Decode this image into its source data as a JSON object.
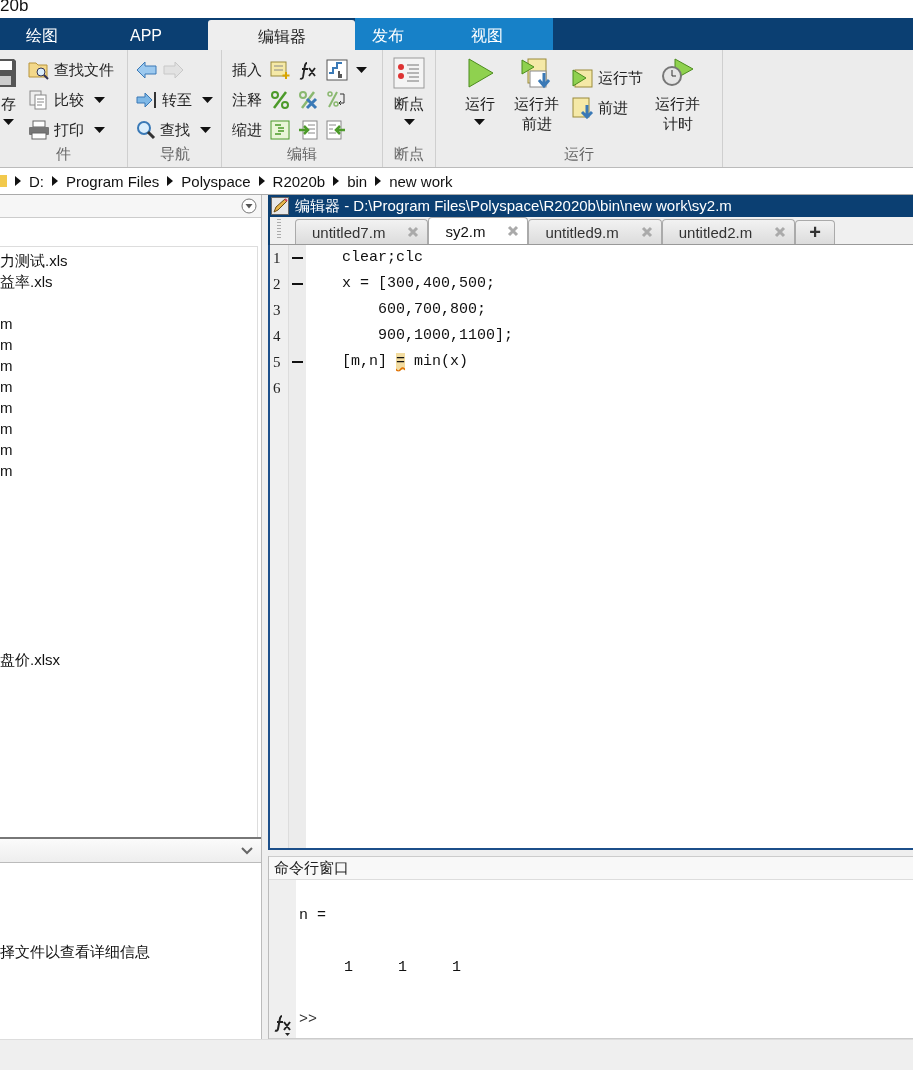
{
  "window": {
    "title_fragment": "20b"
  },
  "tabs": [
    {
      "label": "绘图",
      "selected": false,
      "contextual": false
    },
    {
      "label": "APP",
      "selected": false,
      "contextual": false
    },
    {
      "label": "编辑器",
      "selected": true,
      "contextual": true
    },
    {
      "label": "发布",
      "selected": false,
      "contextual": true
    },
    {
      "label": "视图",
      "selected": false,
      "contextual": true
    }
  ],
  "ribbon": {
    "sections": [
      {
        "label": "件",
        "columns": [
          [
            {
              "kind": "large",
              "label": "存",
              "dropdown": true
            }
          ],
          [
            {
              "kind": "small",
              "label": "查找文件",
              "dropdown": false
            },
            {
              "kind": "small",
              "label": "比较",
              "dropdown": true
            },
            {
              "kind": "small",
              "label": "打印",
              "dropdown": true
            }
          ]
        ]
      },
      {
        "label": "导航",
        "columns": [
          [
            {
              "kind": "arrows",
              "back_disabled": false,
              "forward_disabled": true
            },
            {
              "kind": "small",
              "label": "转至",
              "dropdown": true
            },
            {
              "kind": "small",
              "label": "查找",
              "dropdown": true
            }
          ]
        ]
      },
      {
        "label": "编辑",
        "columns": [
          [
            {
              "kind": "row",
              "label": "插入",
              "dropdown": true
            },
            {
              "kind": "row",
              "label": "注释",
              "dropdown": false
            },
            {
              "kind": "row",
              "label": "缩进",
              "dropdown": false
            }
          ]
        ]
      },
      {
        "label": "断点",
        "columns": [
          [
            {
              "kind": "large",
              "label": "断点",
              "dropdown": true
            }
          ]
        ]
      },
      {
        "label": "运行",
        "columns": [
          [
            {
              "kind": "large",
              "label": "运行",
              "dropdown": true
            }
          ],
          [
            {
              "kind": "large",
              "label": "运行并前进",
              "dropdown": false
            }
          ],
          [
            {
              "kind": "small",
              "label": "运行节",
              "dropdown": false
            },
            {
              "kind": "small",
              "label": "前进",
              "dropdown": false
            }
          ],
          [
            {
              "kind": "large",
              "label": "运行并计时",
              "dropdown": false
            }
          ]
        ]
      }
    ]
  },
  "address_bar": {
    "path": [
      "D:",
      "Program Files",
      "Polyspace",
      "R2020b",
      "bin",
      "new work"
    ]
  },
  "file_browser": {
    "files": [
      {
        "kind": "file",
        "name": "力测试.xls"
      },
      {
        "kind": "file",
        "name": "益率.xls"
      },
      {
        "kind": "cut"
      },
      {
        "kind": "file",
        "name": "m"
      },
      {
        "kind": "file",
        "name": "m"
      },
      {
        "kind": "file",
        "name": "m"
      },
      {
        "kind": "file",
        "name": "m"
      },
      {
        "kind": "file",
        "name": "m"
      },
      {
        "kind": "file",
        "name": "m"
      },
      {
        "kind": "file",
        "name": "m"
      },
      {
        "kind": "file",
        "name": "m"
      },
      {
        "kind": "cut"
      },
      {
        "kind": "cut"
      },
      {
        "kind": "cut"
      },
      {
        "kind": "cut"
      },
      {
        "kind": "cut"
      },
      {
        "kind": "cut"
      },
      {
        "kind": "cut"
      },
      {
        "kind": "cut"
      },
      {
        "kind": "file",
        "name": "盘价.xlsx"
      }
    ],
    "details_message": "择文件以查看详细信息"
  },
  "editor": {
    "title": "编辑器 - D:\\Program Files\\Polyspace\\R2020b\\bin\\new work\\sy2.m",
    "tabs": [
      {
        "label": "untitled7.m",
        "selected": false
      },
      {
        "label": "sy2.m",
        "selected": true
      },
      {
        "label": "untitled9.m",
        "selected": false
      },
      {
        "label": "untitled2.m",
        "selected": false
      }
    ],
    "new_tab": "+",
    "lines": [
      {
        "number": "1",
        "executable": true,
        "segments": [
          {
            "text": "    clear;clc",
            "warning": false
          }
        ]
      },
      {
        "number": "2",
        "executable": true,
        "segments": [
          {
            "text": "    x = [300,400,500;",
            "warning": false
          }
        ]
      },
      {
        "number": "3",
        "executable": false,
        "segments": [
          {
            "text": "        600,700,800;",
            "warning": false
          }
        ]
      },
      {
        "number": "4",
        "executable": false,
        "segments": [
          {
            "text": "        900,1000,1100];",
            "warning": false
          }
        ]
      },
      {
        "number": "5",
        "executable": true,
        "segments": [
          {
            "text": "    [m,n] ",
            "warning": false
          },
          {
            "text": "=",
            "warning": true
          },
          {
            "text": " min(x)",
            "warning": false
          }
        ]
      },
      {
        "number": "6",
        "executable": false
      }
    ]
  },
  "command_window": {
    "title": "命令行窗口",
    "output": [
      "n =",
      "     1     1     1"
    ],
    "prompt": ">>"
  }
}
